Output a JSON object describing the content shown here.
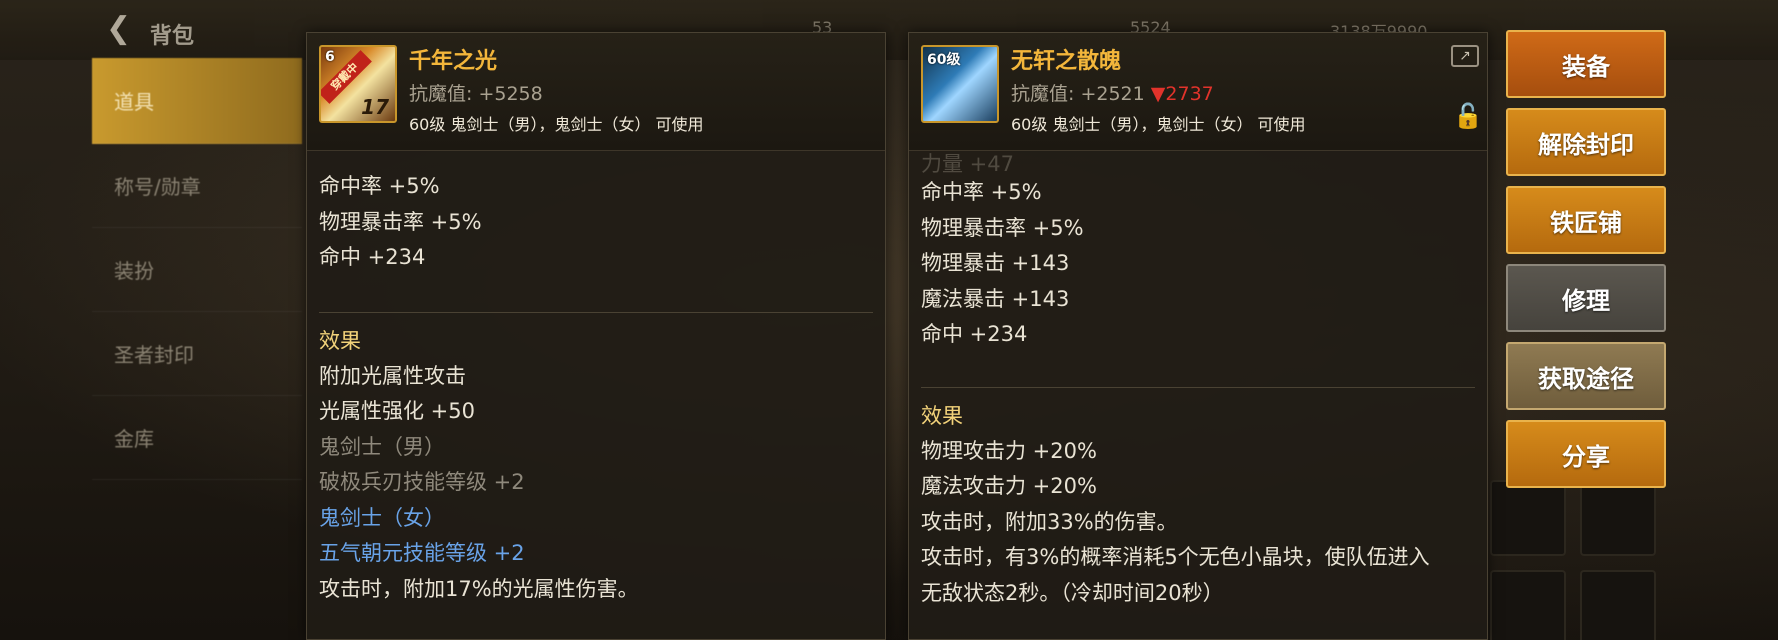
{
  "header": {
    "back_icon": "back-arrow-icon",
    "title": "背包",
    "stats": [
      "53",
      "5524",
      "3138万9990"
    ]
  },
  "sidebar": {
    "items": [
      {
        "label": "道具",
        "active": true
      },
      {
        "label": "称号/勋章",
        "active": false
      },
      {
        "label": "装扮",
        "active": false
      },
      {
        "label": "圣者封印",
        "active": false
      },
      {
        "label": "金库",
        "active": false
      }
    ]
  },
  "left_item": {
    "name": "千年之光",
    "icon_badge": "穿戴中",
    "icon_number": "17",
    "icon_corner": "6",
    "stat_label": "抗魔值:",
    "stat_value": "+5258",
    "usage": "60级 鬼剑士（男），鬼剑士（女） 可使用",
    "stats": [
      "命中率 +5%",
      "物理暴击率 +5%",
      "命中 +234"
    ],
    "effect_title": "效果",
    "effects": [
      {
        "text": "附加光属性攻击",
        "style": "normal"
      },
      {
        "text": "光属性强化 +50",
        "style": "normal"
      },
      {
        "text": "鬼剑士（男）",
        "style": "grey"
      },
      {
        "text": "破极兵刃技能等级 +2",
        "style": "grey"
      },
      {
        "text": "鬼剑士（女）",
        "style": "blue"
      },
      {
        "text": "五气朝元技能等级 +2",
        "style": "blue"
      },
      {
        "text": "攻击时，附加17%的光属性伤害。",
        "style": "normal"
      }
    ]
  },
  "right_item": {
    "name": "无轩之散魄",
    "icon_level": "60级",
    "stat_label": "抗魔值:",
    "stat_value": "+2521",
    "stat_diff": "▼2737",
    "usage": "60级 鬼剑士（男），鬼剑士（女） 可使用",
    "partial_stat": "力量 +47",
    "stats": [
      "命中率 +5%",
      "物理暴击率 +5%",
      "物理暴击 +143",
      "魔法暴击 +143",
      "命中 +234"
    ],
    "effect_title": "效果",
    "effects": [
      "物理攻击力 +20%",
      "魔法攻击力 +20%",
      "攻击时，附加33%的伤害。",
      "攻击时，有3%的概率消耗5个无色小晶块，使队伍进入",
      "无敌状态2秒。（冷却时间20秒）"
    ]
  },
  "actions": {
    "equip": "装备",
    "unseal": "解除封印",
    "blacksmith": "铁匠铺",
    "repair": "修理",
    "obtain": "获取途径",
    "share": "分享"
  },
  "colors": {
    "item_name": "#f3b63b",
    "effect_title": "#f2d27a",
    "down_value": "#e2332b",
    "blue_text": "#69a3e8",
    "button_orange": "#d68b1b"
  }
}
